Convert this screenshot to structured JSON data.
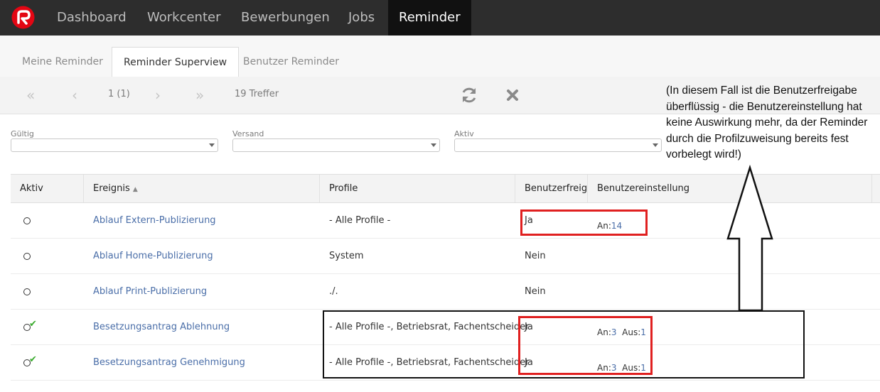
{
  "nav": {
    "items": [
      "Dashboard",
      "Workcenter",
      "Bewerbungen",
      "Jobs",
      "Reminder"
    ],
    "active": "Reminder"
  },
  "tabs": [
    "Meine Reminder",
    "Reminder Superview",
    "Benutzer Reminder"
  ],
  "toolbar": {
    "first_icon": "«",
    "prev_icon": "‹",
    "page_text": "1 (1)",
    "next_icon": "›",
    "last_icon": "»",
    "hits": "19 Treffer",
    "refresh_icon": "refresh-icon",
    "clear_icon": "clear-icon"
  },
  "filters": [
    {
      "label": "Gültig",
      "value": ""
    },
    {
      "label": "Versand",
      "value": ""
    },
    {
      "label": "Aktiv",
      "value": ""
    }
  ],
  "table": {
    "columns": [
      "Aktiv",
      "Ereignis",
      "Profile",
      "Benutzerfreigabe",
      "Benutzereinstellung"
    ],
    "sort_indicator": "▲",
    "rows": [
      {
        "active": false,
        "event": "Ablauf Extern-Publizierung",
        "profiles": "- Alle Profile -",
        "release": "Ja",
        "setting_an_label": "An:",
        "setting_an": "14",
        "setting_aus_label": "",
        "setting_aus": ""
      },
      {
        "active": false,
        "event": "Ablauf Home-Publizierung",
        "profiles": "System",
        "release": "Nein",
        "setting_an_label": "",
        "setting_an": "",
        "setting_aus_label": "",
        "setting_aus": ""
      },
      {
        "active": false,
        "event": "Ablauf Print-Publizierung",
        "profiles": "./.",
        "release": "Nein",
        "setting_an_label": "",
        "setting_an": "",
        "setting_aus_label": "",
        "setting_aus": ""
      },
      {
        "active": true,
        "event": "Besetzungsantrag Ablehnung",
        "profiles": "- Alle Profile -, Betriebsrat, Fachentscheider",
        "release": "Ja",
        "setting_an_label": "An:",
        "setting_an": "3",
        "setting_aus_label": "Aus:",
        "setting_aus": "1"
      },
      {
        "active": true,
        "event": "Besetzungsantrag Genehmigung",
        "profiles": "- Alle Profile -, Betriebsrat, Fachentscheider",
        "release": "Ja",
        "setting_an_label": "An:",
        "setting_an": "3",
        "setting_aus_label": "Aus:",
        "setting_aus": "1"
      }
    ]
  },
  "annotation": {
    "note": "(In diesem Fall ist die Benutzerfreigabe überflüssig - die Benutzereinstellung hat keine Auswirkung mehr, da der Reminder durch die Profilzuweisung bereits fest vorbelegt wird!)"
  },
  "colors": {
    "nav_bg": "#2d2d2d",
    "link": "#4a6ea8",
    "check": "#3aab2e",
    "highlight_red": "#e02020"
  }
}
